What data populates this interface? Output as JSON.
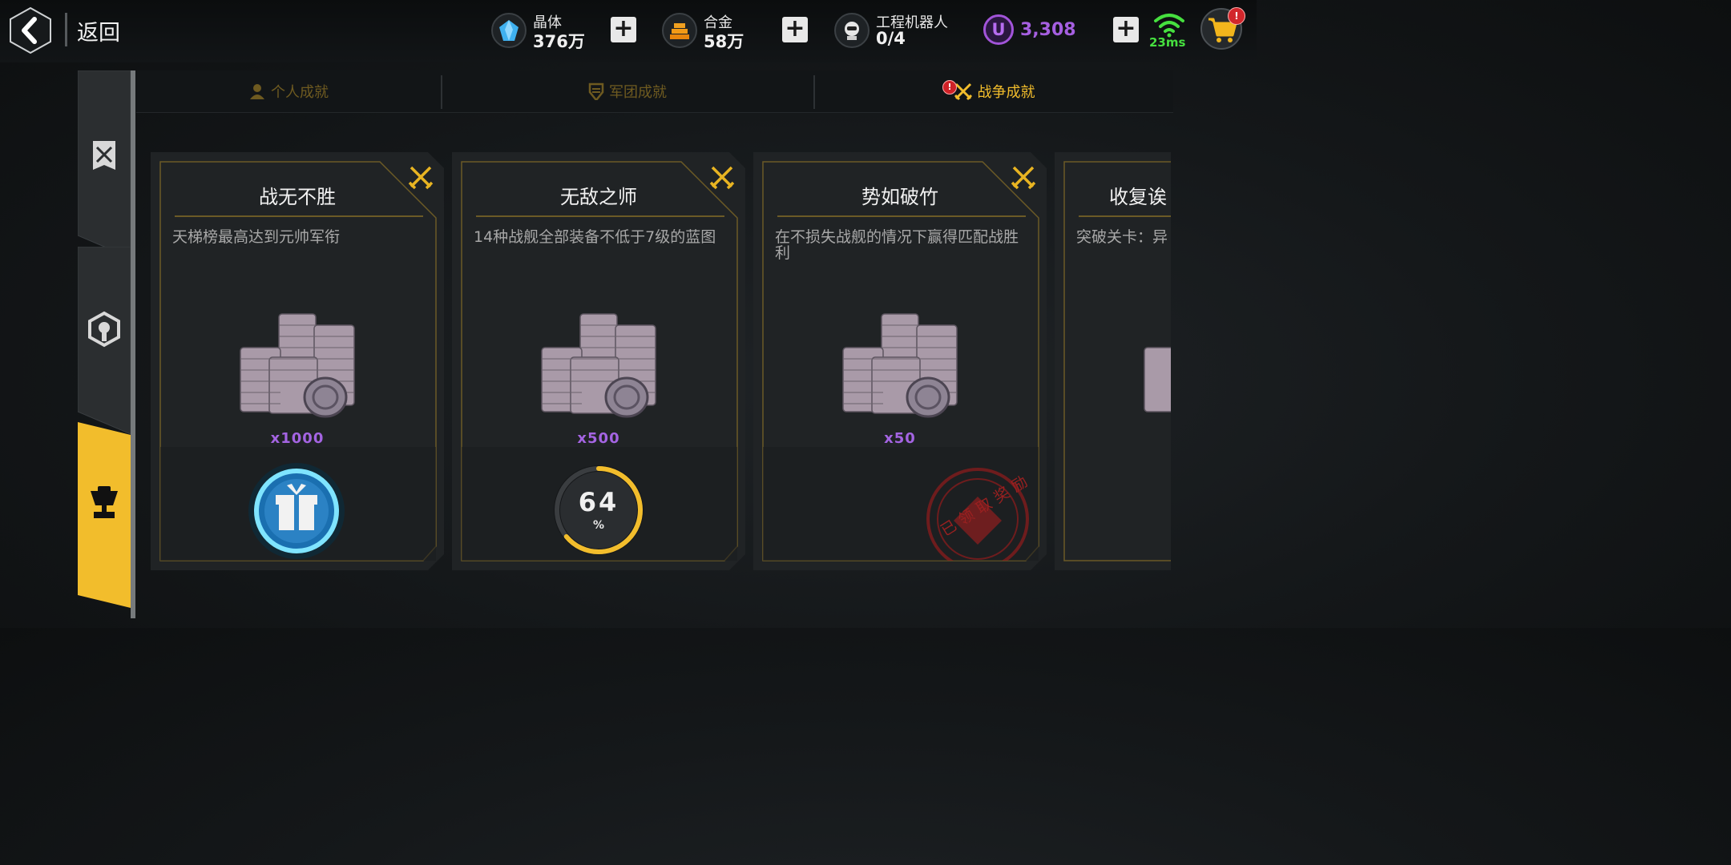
{
  "header": {
    "back_label": "返回",
    "resources": [
      {
        "name": "晶体",
        "value": "376万",
        "icon": "crystal-icon"
      },
      {
        "name": "合金",
        "value": "58万",
        "icon": "alloy-icon"
      },
      {
        "name": "工程机器人",
        "value": "0/4",
        "icon": "robot-icon"
      }
    ],
    "premium": {
      "symbol": "U",
      "value": "3,308"
    },
    "ping": "23ms",
    "cart_badge": "!"
  },
  "tabs": [
    {
      "label": "个人成就",
      "active": false,
      "icon": "person-icon"
    },
    {
      "label": "军团成就",
      "active": false,
      "icon": "legion-shield-icon"
    },
    {
      "label": "战争成就",
      "active": true,
      "icon": "crossed-swords-icon",
      "badge": "!"
    }
  ],
  "side_tabs": [
    {
      "icon": "war-banner-icon",
      "active": false
    },
    {
      "icon": "emblem-icon",
      "active": false
    },
    {
      "icon": "trophy-fist-icon",
      "active": true
    }
  ],
  "cards": [
    {
      "title": "战无不胜",
      "desc": "天梯榜最高达到元帅军衔",
      "qty": "x1000",
      "state": "claimable"
    },
    {
      "title": "无敌之师",
      "desc": "14种战舰全部装备不低于7级的蓝图",
      "qty": "x500",
      "state": "in-progress",
      "progress": 64,
      "progress_unit": "%"
    },
    {
      "title": "势如破竹",
      "desc": "在不损失战舰的情况下赢得匹配战胜利",
      "qty": "x50",
      "state": "claimed",
      "stamp_text": "已领取奖励"
    },
    {
      "title": "收复诶",
      "desc": "突破关卡：异",
      "qty": "",
      "state": "partial"
    }
  ],
  "colors": {
    "accent": "#f2bd2c",
    "premium": "#a55fe0",
    "ping": "#46e03f",
    "badge": "#cf2127"
  }
}
